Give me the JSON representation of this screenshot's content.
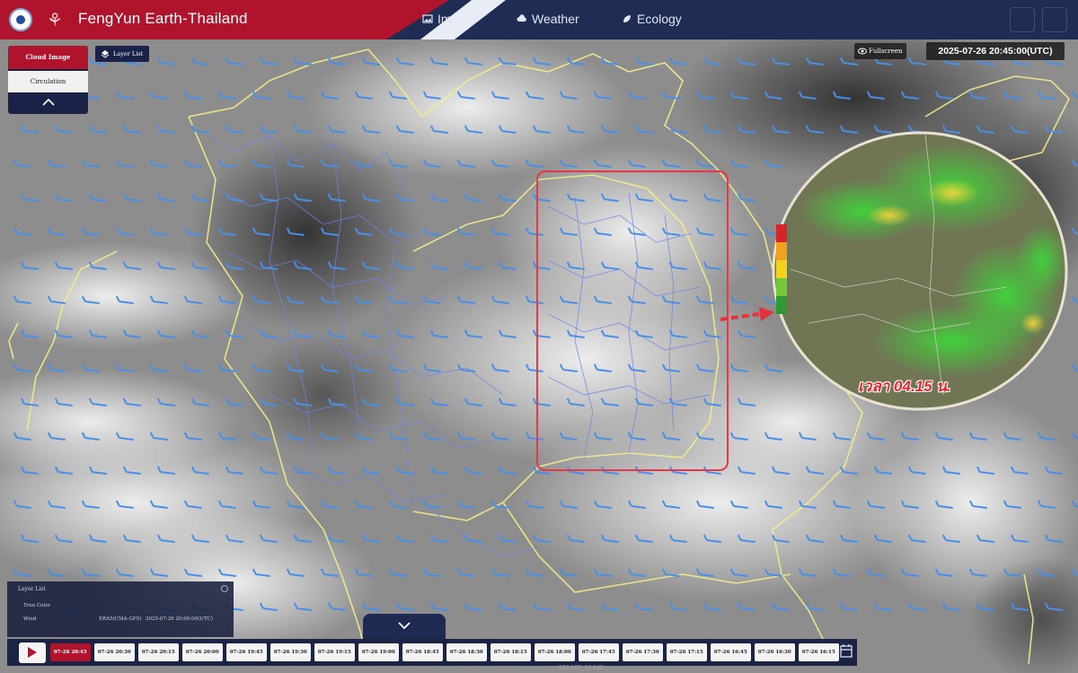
{
  "header": {
    "app_title": "FengYun Earth-Thailand",
    "nav": [
      {
        "label": "Im",
        "icon": "image-icon"
      },
      {
        "label": "Weather",
        "icon": "cloud-icon"
      },
      {
        "label": "Ecology",
        "icon": "leaf-icon"
      }
    ],
    "colors": {
      "brand_red": "#b0142c",
      "nav_bg": "#1f2d54"
    }
  },
  "side_tabs": {
    "cloud_image": "Cloud Image",
    "circulation": "Circulation"
  },
  "layer_list_button": "Layer List",
  "fullscreen_label": "Fullscreen",
  "timestamp": "2025-07-26 20:45:00(UTC)",
  "layer_panel": {
    "title": "Layer List",
    "rows": [
      {
        "label": "True Color"
      },
      {
        "label": "Wind",
        "source": "ERA5(CMA-GFS)",
        "time": "2025-07-26 20:00:00(UTC)"
      }
    ]
  },
  "radar": {
    "time_label": "เวลา 04.15 น."
  },
  "timeline": {
    "frames": [
      "07-26 20:45",
      "07-26 20:30",
      "07-26 20:15",
      "07-26 20:00",
      "07-26 19:45",
      "07-26 19:30",
      "07-26 19:15",
      "07-26 19:00",
      "07-26 18:45",
      "07-26 18:30",
      "07-26 18:15",
      "07-26 18:00",
      "07-26 17:45",
      "07-26 17:30",
      "07-26 17:15",
      "07-26 16:45",
      "07-26 16:30",
      "07-26 16:15"
    ],
    "active_index": 0
  },
  "coordinates": "102.167, 15.642"
}
